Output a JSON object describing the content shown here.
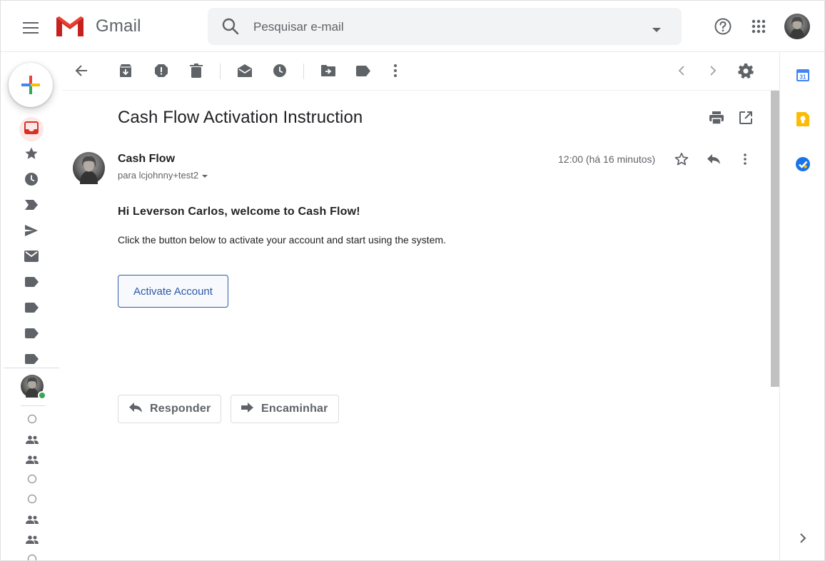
{
  "app": {
    "logo_text": "Gmail",
    "brand_red": "#EA4335"
  },
  "header": {
    "menu_icon": "hamburger-menu-icon",
    "search_placeholder": "Pesquisar e-mail",
    "search_value": "",
    "help_icon": "help-icon",
    "apps_icon": "apps-grid-icon"
  },
  "rail": {
    "compose_icon": "plus-icon",
    "items": [
      {
        "icon": "inbox-icon",
        "active": true
      },
      {
        "icon": "star-icon"
      },
      {
        "icon": "clock-icon"
      },
      {
        "icon": "important-icon"
      },
      {
        "icon": "send-icon"
      },
      {
        "icon": "mail-icon"
      },
      {
        "icon": "label-icon"
      },
      {
        "icon": "label-icon"
      },
      {
        "icon": "label-icon"
      },
      {
        "icon": "label-icon"
      }
    ],
    "presence_color": "#34a853"
  },
  "toolbar": {
    "icons": [
      "back-arrow-icon",
      "archive-icon",
      "spam-icon",
      "delete-icon",
      "mark-unread-icon",
      "snooze-icon",
      "move-to-icon",
      "label-icon",
      "more-vert-icon",
      "prev-icon",
      "next-icon",
      "settings-icon"
    ]
  },
  "message": {
    "subject": "Cash Flow Activation Instruction",
    "sender": "Cash Flow",
    "recipient": "para lcjohnny+test2",
    "time": "12:00 (há 16 minutos)",
    "greeting": "Hi Leverson Carlos, welcome to Cash Flow!",
    "body": "Click the button below to activate your account and start using the system.",
    "cta_label": "Activate Account",
    "cta_color": "#2f5ca8",
    "reply_label": "Responder",
    "forward_label": "Encaminhar"
  },
  "side_panel": {
    "calendar_day": "31",
    "icons": [
      "calendar-icon",
      "keep-icon",
      "tasks-icon",
      "expand-panel-icon"
    ]
  }
}
